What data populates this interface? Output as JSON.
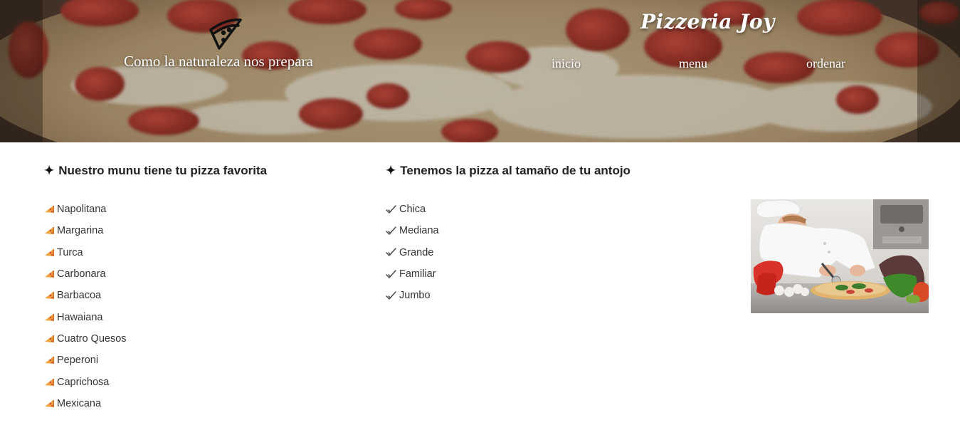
{
  "header": {
    "tagline": "Como la naturaleza nos prepara",
    "brand": "Pizzeria Joy",
    "logo_icon": "pizza-slice-icon",
    "background": "pepperoni-pizza-photo",
    "nav": [
      {
        "label": "inicio"
      },
      {
        "label": "menu"
      },
      {
        "label": "ordenar"
      }
    ]
  },
  "menu_section": {
    "heading": "Nuestro munu tiene tu pizza favorita",
    "heading_icon": "sparkle-icon",
    "item_icon": "pizza-slice-icon",
    "items": [
      "Napolitana",
      "Margarina",
      "Turca",
      "Carbonara",
      "Barbacoa",
      "Hawaiana",
      "Cuatro Quesos",
      "Peperoni",
      "Caprichosa",
      "Mexicana"
    ]
  },
  "sizes_section": {
    "heading": "Tenemos la pizza al tamaño de tu antojo",
    "heading_icon": "sparkle-icon",
    "item_icon": "checkmark-icon",
    "items": [
      "Chica",
      "Mediana",
      "Grande",
      "Familiar",
      "Jumbo"
    ]
  },
  "photo": {
    "subject": "chef-cutting-pizza-photo"
  },
  "colors": {
    "nav_text": "#ffffff",
    "body_text": "#333333",
    "slice_icon": "#f2a23a"
  }
}
